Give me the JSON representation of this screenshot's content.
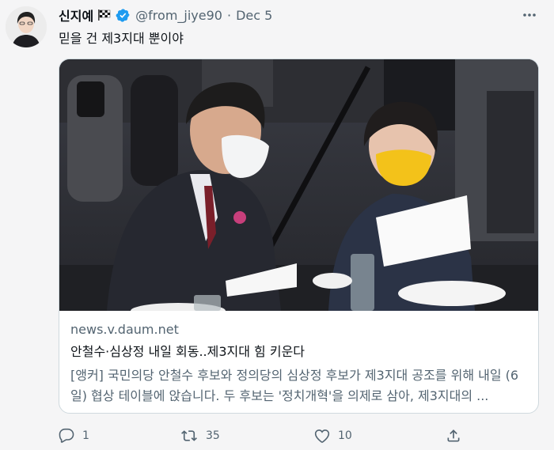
{
  "tweet": {
    "display_name": "신지예",
    "flag_emoji": "chequered-flag",
    "verified": true,
    "handle": "@from_jiye90",
    "separator": "·",
    "date": "Dec 5",
    "text": "믿을 건 제3지대 뿐이야"
  },
  "card": {
    "domain": "news.v.daum.net",
    "title": "안철수·심상정 내일 회동..제3지대 힘 키운다",
    "description": "[앵커] 국민의당 안철수 후보와 정의당의 심상정 후보가 제3지대 공조를 위해 내일 (6일) 협상 테이블에 앉습니다. 두 후보는 '정치개혁'을 의제로 삼아, 제3지대의 ..."
  },
  "actions": {
    "reply_count": "1",
    "retweet_count": "35",
    "like_count": "10"
  },
  "colors": {
    "verified_blue": "#1d9bf0",
    "muted_text": "#536471",
    "primary_text": "#0f1419",
    "card_border": "#cfd9de"
  }
}
